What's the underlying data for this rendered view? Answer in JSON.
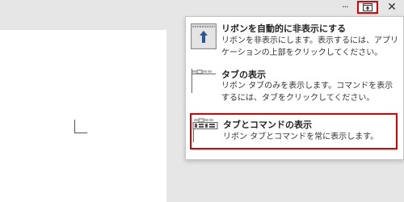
{
  "titlebar": {
    "more_icon": "ellipsis-icon",
    "more_glyph": "···",
    "ribbon_display_icon": "ribbon-display-options-icon",
    "close_icon": "close-icon",
    "close_glyph": "✕"
  },
  "ribbon_menu": {
    "options": [
      {
        "title": "リボンを自動的に非表示にする",
        "description": "リボンを非表示にします。表示するには、アプリケーションの上部をクリックしてください。",
        "icon": "auto-hide-ribbon-icon",
        "highlighted": false
      },
      {
        "title": "タブの表示",
        "description": "リボン タブのみを表示します。コマンドを表示するには、タブをクリックしてください。",
        "icon": "show-tabs-icon",
        "highlighted": false
      },
      {
        "title": "タブとコマンドの表示",
        "description": "リボン タブとコマンドを常に表示します。",
        "icon": "show-tabs-and-commands-icon",
        "highlighted": true
      }
    ]
  },
  "colors": {
    "highlight": "#e00000",
    "menu_background": "#ffffff",
    "window_background": "#e6e6e6",
    "icon_blue": "#2b579a"
  }
}
